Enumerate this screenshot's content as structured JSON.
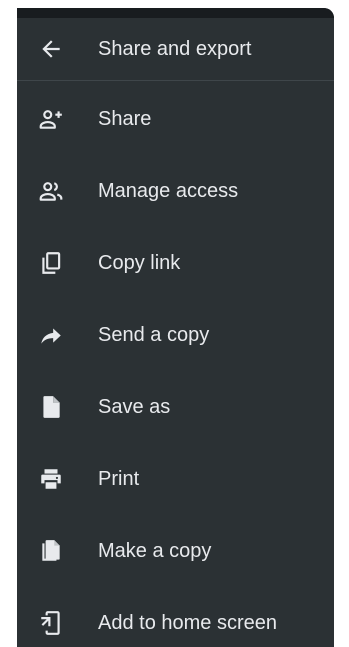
{
  "header": {
    "title": "Share and export",
    "back_icon": "arrow-back-icon"
  },
  "menu": {
    "items": [
      {
        "label": "Share",
        "icon": "person-add-icon"
      },
      {
        "label": "Manage access",
        "icon": "people-icon"
      },
      {
        "label": "Copy link",
        "icon": "copy-link-icon"
      },
      {
        "label": "Send a copy",
        "icon": "send-arrow-icon"
      },
      {
        "label": "Save as",
        "icon": "file-icon"
      },
      {
        "label": "Print",
        "icon": "print-icon"
      },
      {
        "label": "Make a copy",
        "icon": "file-copy-icon"
      },
      {
        "label": "Add to home screen",
        "icon": "add-to-home-icon"
      }
    ]
  },
  "colors": {
    "panel_background": "#2b3134",
    "text": "#e8eaed",
    "divider": "#3f464a"
  }
}
